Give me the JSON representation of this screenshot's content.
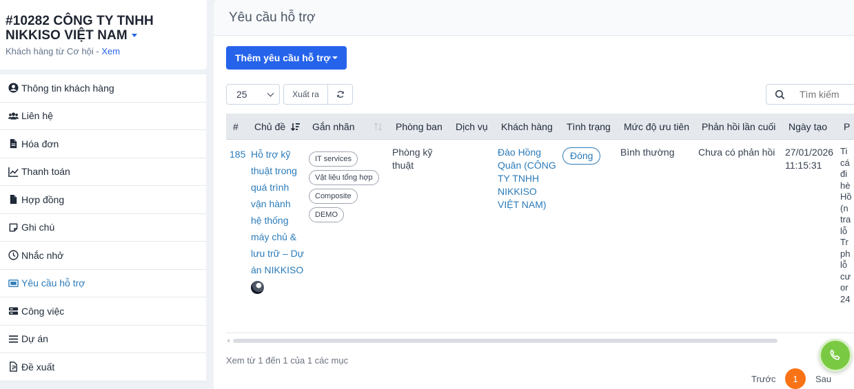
{
  "customer": {
    "name_line1": "#10282 CÔNG TY TNHH",
    "name_line2": "NIKKISO VIỆT NAM",
    "source_text": "Khách hàng từ Cơ hội - ",
    "view_link": "Xem"
  },
  "sidebar": {
    "items": [
      {
        "label": "Thông tin khách hàng",
        "icon": "user-circle-icon"
      },
      {
        "label": "Liên hệ",
        "icon": "users-icon"
      },
      {
        "label": "Hóa đơn",
        "icon": "file-icon"
      },
      {
        "label": "Thanh toán",
        "icon": "chart-line-icon"
      },
      {
        "label": "Hợp đồng",
        "icon": "file-icon"
      },
      {
        "label": "Ghi chú",
        "icon": "note-icon"
      },
      {
        "label": "Nhắc nhở",
        "icon": "clock-icon"
      },
      {
        "label": "Yêu cầu hỗ trợ",
        "icon": "ticket-icon",
        "active": true
      },
      {
        "label": "Công việc",
        "icon": "tasks-icon"
      },
      {
        "label": "Dự án",
        "icon": "bars-icon"
      },
      {
        "label": "Đề xuất",
        "icon": "file-icon"
      }
    ]
  },
  "main": {
    "title": "Yêu cầu hỗ trợ",
    "add_button": "Thêm yêu cầu hỗ trợ",
    "page_size": "25",
    "export_label": "Xuất ra",
    "search_placeholder": "Tìm kiếm"
  },
  "table": {
    "headers": [
      "#",
      "Chủ đề",
      "Gắn nhãn",
      "Phòng ban",
      "Dịch vụ",
      "Khách hàng",
      "Tình trạng",
      "Mức độ ưu tiên",
      "Phản hồi lần cuối",
      "Ngày tạo",
      "P"
    ],
    "row": {
      "id": "185",
      "subject_lines": [
        "Hỗ trợ kỹ",
        "thuật trong",
        "quá trình",
        "vận hành",
        "hệ thống",
        "máy chủ &",
        "lưu trữ – Dự",
        "án NIKKISO"
      ],
      "tags": [
        "IT services",
        "Vật liệu tổng hợp",
        "Composite",
        "DEMO"
      ],
      "department_lines": [
        "Phòng kỹ",
        "thuật"
      ],
      "service": "",
      "customer_lines": [
        "Đào Hồng",
        "Quân (CÔNG",
        "TY TNHH",
        "NIKKISO",
        "VIỆT NAM)"
      ],
      "status": "Đóng",
      "priority": "Bình thường",
      "last_reply": "Chưa có phản hồi",
      "created_date": "27/01/2026",
      "created_time": "11:15:31",
      "overflow_lines": [
        "Ti",
        "cá",
        "đi",
        "hè",
        "Hồ",
        "(n",
        "tra",
        "lỗ",
        "Tr",
        "ph",
        "lỗ",
        "cư",
        "or",
        "24"
      ]
    }
  },
  "footer": {
    "info": "Xem từ 1 đến 1 của 1 các mục",
    "prev": "Trước",
    "current_page": "1",
    "next": "Sau"
  },
  "colors": {
    "primary": "#2563eb",
    "link": "#2b7bb9",
    "page_active": "#f97316",
    "call_button": "#7ac943"
  }
}
